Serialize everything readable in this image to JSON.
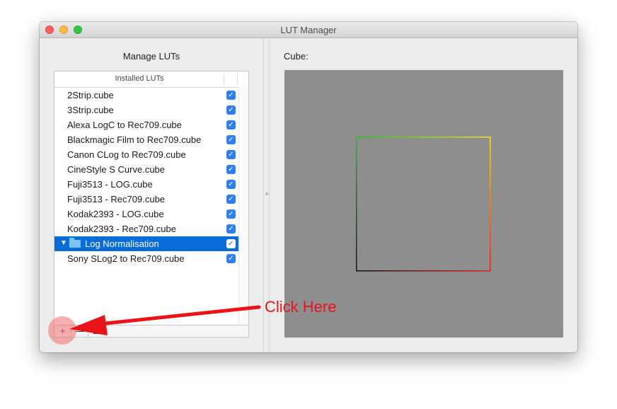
{
  "window": {
    "title": "LUT Manager"
  },
  "left_panel": {
    "heading": "Manage LUTs",
    "table": {
      "column_header": "Installed LUTs",
      "rows": [
        {
          "label": "2Strip.cube",
          "checked": true
        },
        {
          "label": "3Strip.cube",
          "checked": true
        },
        {
          "label": "Alexa LogC to Rec709.cube",
          "checked": true
        },
        {
          "label": "Blackmagic Film to Rec709.cube",
          "checked": true
        },
        {
          "label": "Canon CLog to Rec709.cube",
          "checked": true
        },
        {
          "label": "CineStyle S Curve.cube",
          "checked": true
        },
        {
          "label": "Fuji3513 - LOG.cube",
          "checked": true
        },
        {
          "label": "Fuji3513 - Rec709.cube",
          "checked": true
        },
        {
          "label": "Kodak2393 - LOG.cube",
          "checked": true
        },
        {
          "label": "Kodak2393 - Rec709.cube",
          "checked": true
        },
        {
          "label": "Log Normalisation",
          "checked": true,
          "folder": true,
          "selected": true
        },
        {
          "label": "Sony SLog2 to Rec709.cube",
          "checked": true
        }
      ]
    },
    "footer_buttons": {
      "add": "+",
      "remove": "—"
    }
  },
  "right_panel": {
    "label": "Cube:"
  },
  "annotation": {
    "text": "Click Here",
    "color": "#e8141a"
  },
  "icons": {
    "checkmark": "✓",
    "disclosure": "▼"
  },
  "colors": {
    "selection": "#0a6cd9",
    "checkbox": "#2f7ff2",
    "canvas": "#8e8e8e"
  }
}
